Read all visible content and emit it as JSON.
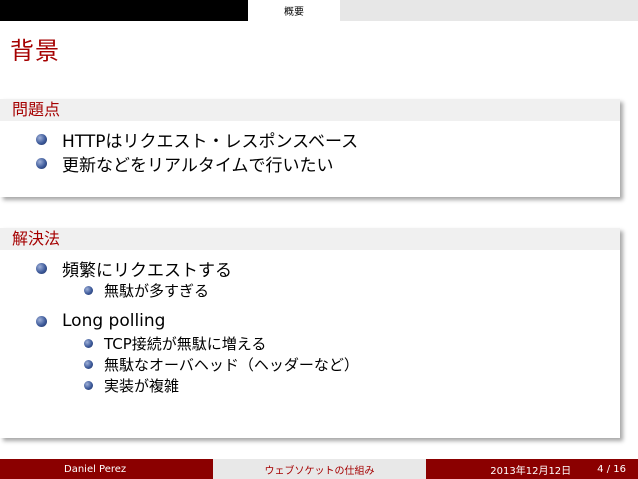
{
  "header": {
    "section": "概要"
  },
  "frame": {
    "title": "背景"
  },
  "problem_block": {
    "title": "問題点",
    "items": [
      "HTTPはリクエスト・レスポンスベース",
      "更新などをリアルタイムで行いたい"
    ]
  },
  "solution_block": {
    "title": "解決法",
    "items": [
      {
        "label": "頻繁にリクエストする",
        "subitems": [
          "無駄が多すぎる"
        ]
      },
      {
        "label": "Long polling",
        "subitems": [
          "TCP接続が無駄に増える",
          "無駄なオーバヘッド（ヘッダーなど）",
          "実装が複雑"
        ]
      }
    ]
  },
  "footer": {
    "author": "Daniel Perez",
    "talk_title": "ウェブソケットの仕組み",
    "date": "2013年12月12日",
    "page": "4 / 16"
  },
  "colors": {
    "accent": "#a50000",
    "footer_dark": "#8b0000",
    "bullet": "#3d5a9a"
  }
}
